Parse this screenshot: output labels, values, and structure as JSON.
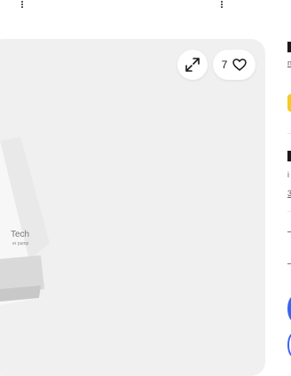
{
  "gallery": {
    "like_count": "7",
    "product_brand_text": "Tech",
    "product_sub_text": "er pump"
  },
  "icons": {
    "expand": "expand-icon",
    "heart": "heart-icon",
    "more_left": "more-vertical-icon",
    "more_right": "more-vertical-icon"
  },
  "side_text": {
    "line1": "n",
    "line2": "i",
    "line3": "3"
  },
  "colors": {
    "accent_blue": "#3665f3",
    "star_yellow": "#f5cb1f",
    "gallery_bg": "#f0f0f0"
  }
}
